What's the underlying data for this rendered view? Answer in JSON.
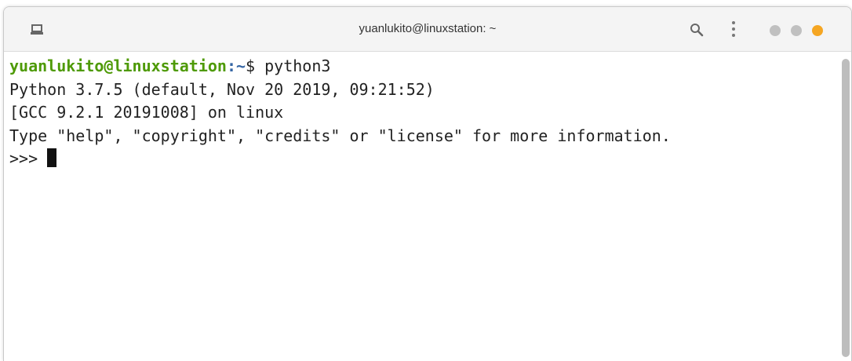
{
  "window": {
    "title": "yuanlukito@linuxstation: ~",
    "controls": {
      "minimize_color": "#c0c0c0",
      "maximize_color": "#c0c0c0",
      "close_color": "#f5a623"
    }
  },
  "icons": {
    "new_tab": "new-tab-icon",
    "search": "search-icon",
    "menu": "kebab-menu-icon"
  },
  "terminal": {
    "prompt_user_host": "yuanlukito@linuxstation",
    "prompt_path": ":~",
    "prompt_symbol": "$ ",
    "command": "python3",
    "output": [
      "Python 3.7.5 (default, Nov 20 2019, 09:21:52)",
      "[GCC 9.2.1 20191008] on linux",
      "Type \"help\", \"copyright\", \"credits\" or \"license\" for more information."
    ],
    "repl_prompt": ">>> "
  }
}
